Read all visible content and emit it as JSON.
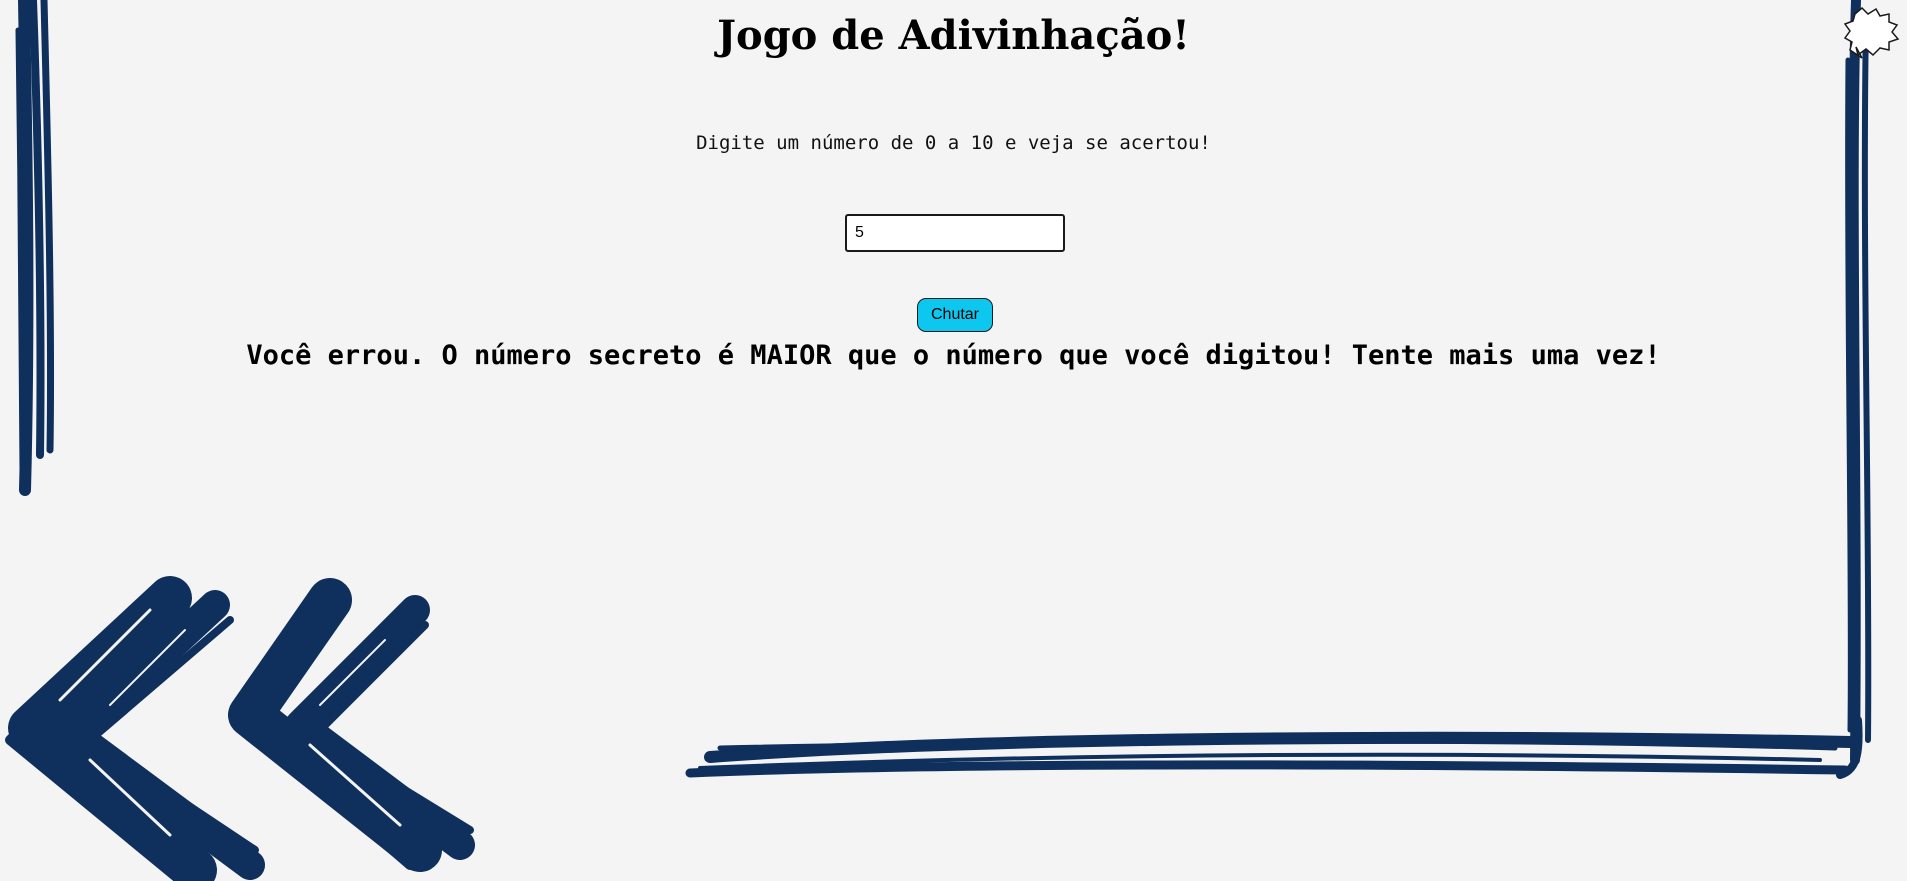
{
  "page": {
    "title": "Jogo de Adivinhação!",
    "instructions": "Digite um número de 0 a 10 e veja se acertou!",
    "guess_input_value": "5",
    "guess_button_label": "Chutar",
    "result_message": "Você errou. O número secreto é MAIOR que o número que você digitou! Tente mais uma vez!"
  },
  "decorations": {
    "scribble_color": "#0f2f5c",
    "button_color": "#0ec7ee",
    "icons": [
      "left-scribble-line",
      "right-scribble-frame",
      "double-chevron-left-icon",
      "speech-bubble-icon"
    ]
  }
}
